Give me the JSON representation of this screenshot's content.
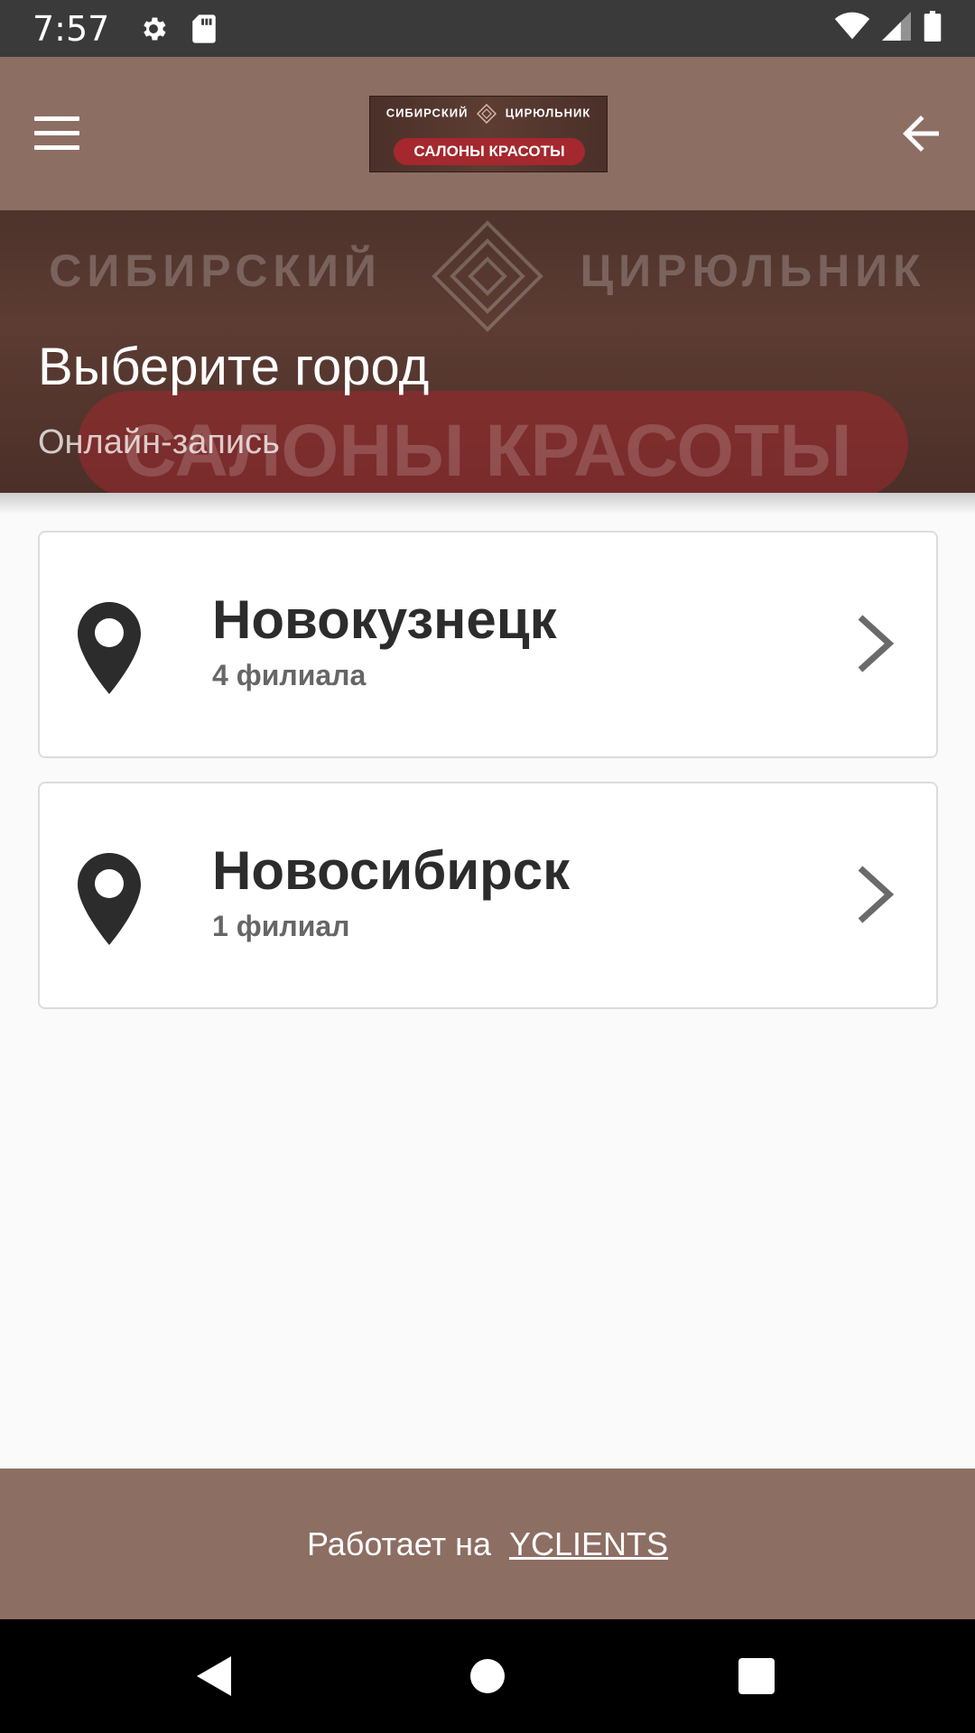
{
  "status_bar": {
    "time": "7:57",
    "icons": [
      "gear-icon",
      "sd-card-icon",
      "wifi-icon",
      "signal-icon",
      "battery-icon"
    ]
  },
  "app_bar": {
    "menu_icon": "hamburger-menu-icon",
    "back_icon": "arrow-back-icon",
    "logo": {
      "line1_left": "СИБИРСКИЙ",
      "line1_right": "ЦИРЮЛЬНИК",
      "line2": "САЛОНЫ КРАСОТЫ"
    },
    "background_color": "#8d6e63"
  },
  "hero": {
    "bg_top_left": "СИБИРСКИЙ",
    "bg_top_right": "ЦИРЮЛЬНИК",
    "bg_bottom": "САЛОНЫ КРАСОТЫ",
    "title": "Выберите город",
    "subtitle": "Онлайн-запись"
  },
  "cities": [
    {
      "name": "Новокузнецк",
      "branches": "4 филиала",
      "icon": "map-pin-icon"
    },
    {
      "name": "Новосибирск",
      "branches": "1 филиал",
      "icon": "map-pin-icon"
    }
  ],
  "footer": {
    "text": "Работает на",
    "link": "YCLIENTS"
  },
  "nav_bar": {
    "icons": [
      "nav-back-icon",
      "nav-home-icon",
      "nav-recents-icon"
    ]
  },
  "colors": {
    "accent": "#8d6e63",
    "logo_red": "#a4282d",
    "card_text": "#2c2c2c"
  }
}
